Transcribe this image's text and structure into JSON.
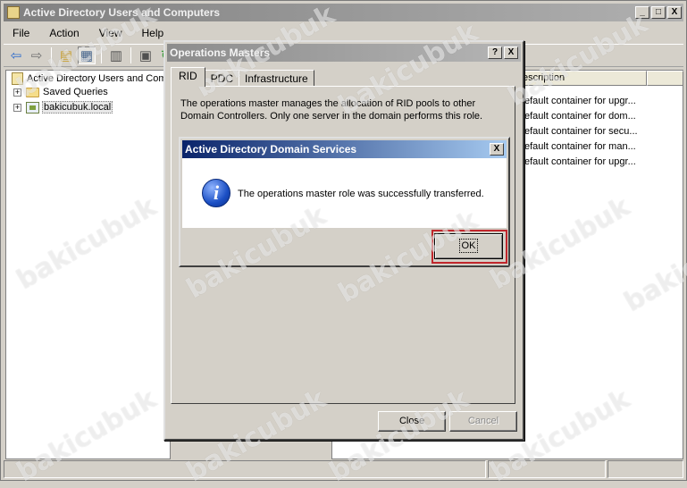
{
  "main_window": {
    "title": "Active Directory Users and Computers",
    "buttons": {
      "minimize": "_",
      "maximize": "□",
      "close": "X"
    }
  },
  "menu": [
    "File",
    "Action",
    "View",
    "Help"
  ],
  "tree": {
    "root": "Active Directory Users and Com",
    "items": [
      {
        "label": "Saved Queries",
        "expander": "+"
      },
      {
        "label": "bakicubuk.local",
        "expander": "+"
      }
    ]
  },
  "list": {
    "column": "escription",
    "rows": [
      "efault container for upgr...",
      "efault container for dom...",
      "efault container for secu...",
      "efault container for man...",
      "efault container for upgr..."
    ]
  },
  "ops_dialog": {
    "title": "Operations Masters",
    "help_button": "?",
    "close_button": "X",
    "tabs": [
      "RID",
      "PDC",
      "Infrastructure"
    ],
    "active_tab": "RID",
    "description": "The operations master manages the allocation of RID pools to other Domain Controllers. Only one server in the domain performs this role.",
    "close_label": "Close",
    "cancel_label": "Cancel"
  },
  "message_box": {
    "title": "Active Directory Domain Services",
    "close_button": "X",
    "icon": "info-icon",
    "message": "The operations master role was successfully transferred.",
    "ok_label": "OK",
    "highlight_color": "#c0262c"
  },
  "watermark": "bakicubuk"
}
